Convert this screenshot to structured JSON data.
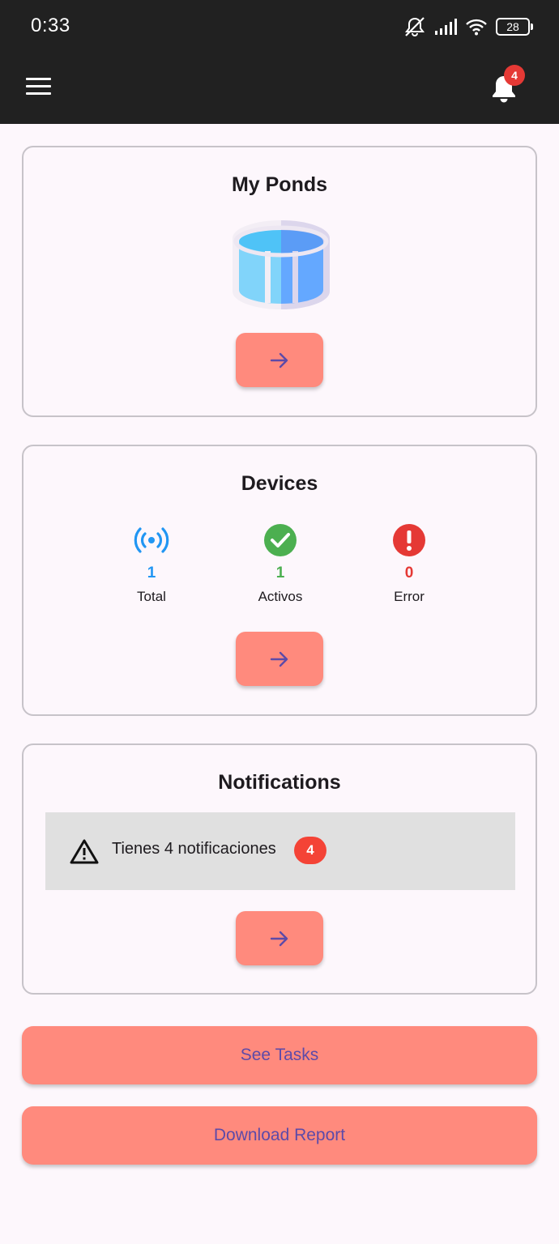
{
  "status_bar": {
    "time": "0:33",
    "battery": "28",
    "icons": [
      "notifications-off-icon",
      "signal-icon",
      "wifi-icon",
      "battery-icon"
    ]
  },
  "app_bar": {
    "menu_icon": "menu-icon",
    "bell_icon": "bell-icon",
    "notification_count": "4"
  },
  "ponds_card": {
    "title": "My Ponds",
    "image_icon": "pond-icon",
    "button_icon": "arrow-right-icon"
  },
  "devices_card": {
    "title": "Devices",
    "stats": [
      {
        "icon": "signal-broadcast-icon",
        "value": "1",
        "label": "Total",
        "color": "#2196f3"
      },
      {
        "icon": "check-circle-icon",
        "value": "1",
        "label": "Activos",
        "color": "#4caf50"
      },
      {
        "icon": "error-circle-icon",
        "value": "0",
        "label": "Error",
        "color": "#e53935"
      }
    ],
    "button_icon": "arrow-right-icon"
  },
  "notifications_card": {
    "title": "Notifications",
    "warning_icon": "warning-icon",
    "message": "Tienes 4 notificaciones",
    "badge": "4",
    "button_icon": "arrow-right-icon"
  },
  "actions": {
    "see_tasks": "See Tasks",
    "download_report": "Download Report"
  },
  "colors": {
    "primary_button": "#ff8a7d",
    "button_text": "#5d4aa8",
    "app_bar": "#212121",
    "background": "#fdf7fc"
  }
}
